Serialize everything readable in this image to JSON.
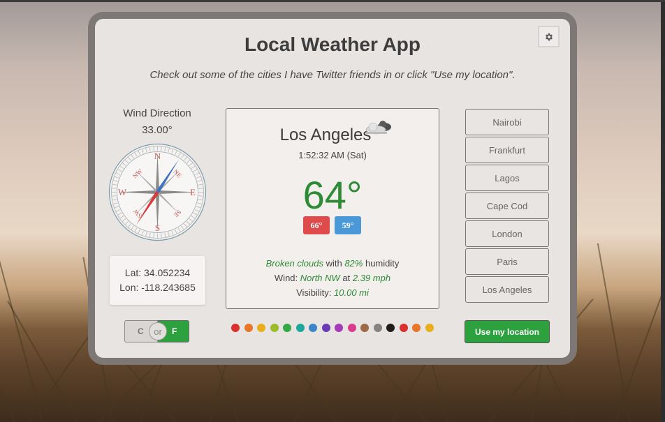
{
  "app": {
    "title": "Local Weather App",
    "subtitle": "Check out some of the cities I have Twitter friends in or click \"Use my location\".",
    "settings_icon": "gear-icon"
  },
  "wind": {
    "title": "Wind Direction",
    "degrees_label": "33.00°",
    "degrees": 33.0,
    "compass_labels": {
      "n": "N",
      "ne": "NE",
      "e": "E",
      "se": "SE",
      "s": "S",
      "sw": "SW",
      "w": "W",
      "nw": "NW"
    }
  },
  "coords": {
    "lat": "Lat: 34.052234",
    "lon": "Lon: -118.243685"
  },
  "units": {
    "celsius": "C",
    "or": "or",
    "fahrenheit": "F",
    "selected": "F"
  },
  "weather": {
    "city": "Los Angeles",
    "icon": "broken-clouds-icon",
    "local_time": "1:52:32 AM (Sat)",
    "temperature": "64°",
    "high": "66°",
    "low": "59°",
    "condition": "Broken clouds",
    "with": " with ",
    "humidity": "82%",
    "humidity_label": " humidity",
    "wind_prefix": "Wind: ",
    "wind_dir": "North NW",
    "wind_at": " at ",
    "wind_speed": "2.39 mph",
    "visibility_prefix": "Visibility: ",
    "visibility": "10.00 mi"
  },
  "theme_colors": [
    "#d9322e",
    "#e8762a",
    "#eaae1d",
    "#9cbb2a",
    "#33a844",
    "#1ea89b",
    "#3a86c6",
    "#6a3bb7",
    "#a43bb7",
    "#d93d8d",
    "#9e6b44",
    "#858280",
    "#1f1d1c",
    "#d9322e",
    "#e8762a",
    "#eaae1d"
  ],
  "cities": [
    "Nairobi",
    "Frankfurt",
    "Lagos",
    "Cape Cod",
    "London",
    "Paris",
    "Los Angeles"
  ],
  "use_location_label": "Use my location"
}
